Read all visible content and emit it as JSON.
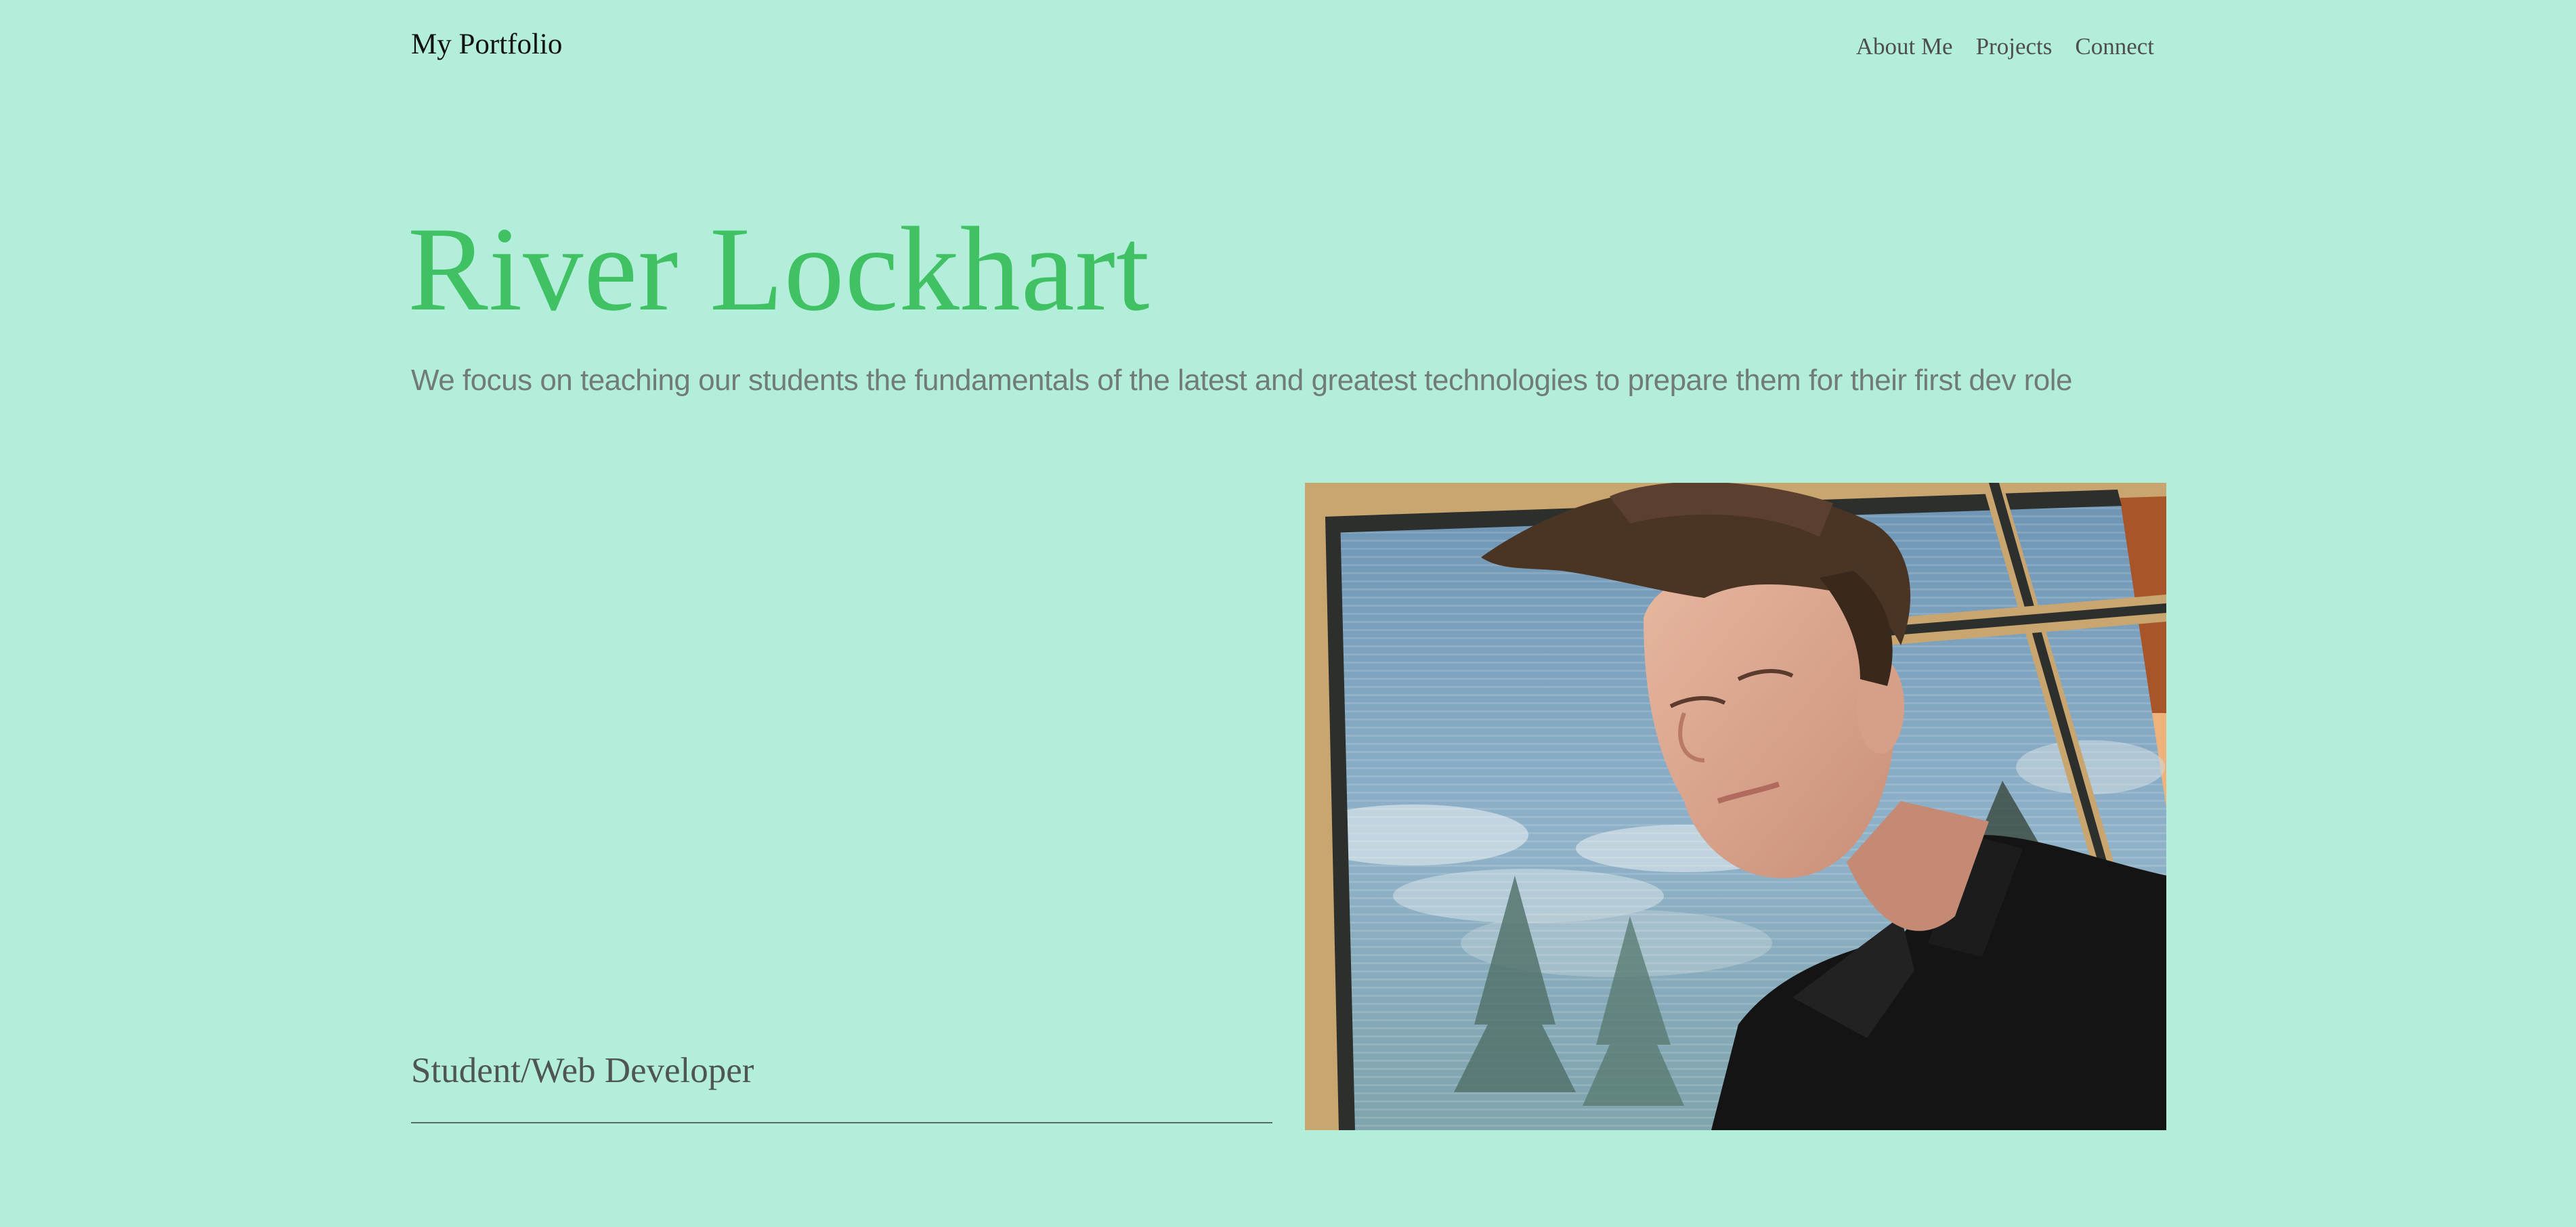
{
  "nav": {
    "brand": "My Portfolio",
    "links": [
      "About Me",
      "Projects",
      "Connect"
    ]
  },
  "hero": {
    "name": "River Lockhart",
    "tagline": "We focus on teaching our students the fundamentals of the latest and greatest technologies to prepare them for their first dev role"
  },
  "profile": {
    "role": "Student/Web Developer"
  },
  "colors": {
    "background": "#b3eedb",
    "accent": "#3fc164",
    "brand_text": "#121212",
    "nav_text": "#4e4e4e",
    "tagline_text": "#717b77"
  }
}
